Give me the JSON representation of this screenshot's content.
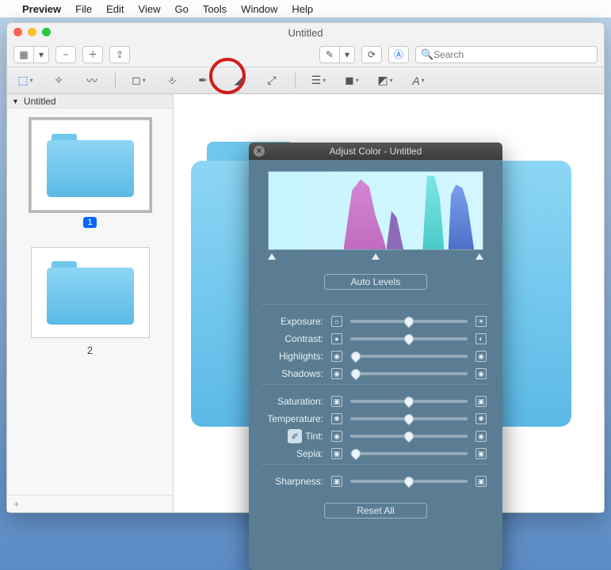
{
  "menubar": {
    "apple": "",
    "app": "Preview",
    "items": [
      "File",
      "Edit",
      "View",
      "Go",
      "Tools",
      "Window",
      "Help"
    ]
  },
  "window": {
    "title": "Untitled",
    "search_placeholder": "Search",
    "sidebar_title": "Untitled",
    "thumbs": [
      {
        "page": "1",
        "selected": true
      },
      {
        "page": "2",
        "selected": false
      }
    ],
    "add_icon": "+"
  },
  "panel": {
    "title": "Adjust Color - Untitled",
    "auto_levels": "Auto Levels",
    "reset": "Reset All",
    "groups": [
      {
        "name": "light",
        "rows": [
          {
            "key": "exposure",
            "label": "Exposure:",
            "pos": 50,
            "left_icon": "☼",
            "right_icon": "☀"
          },
          {
            "key": "contrast",
            "label": "Contrast:",
            "pos": 50,
            "left_icon": "●",
            "right_icon": "◐"
          },
          {
            "key": "highlights",
            "label": "Highlights:",
            "pos": 5,
            "left_icon": "◉",
            "right_icon": "◉"
          },
          {
            "key": "shadows",
            "label": "Shadows:",
            "pos": 5,
            "left_icon": "◉",
            "right_icon": "◉"
          }
        ]
      },
      {
        "name": "color",
        "rows": [
          {
            "key": "saturation",
            "label": "Saturation:",
            "pos": 50,
            "left_icon": "▣",
            "right_icon": "▣"
          },
          {
            "key": "temperature",
            "label": "Temperature:",
            "pos": 50,
            "left_icon": "✺",
            "right_icon": "✺"
          },
          {
            "key": "tint",
            "label": "Tint:",
            "pos": 50,
            "left_icon": "◉",
            "right_icon": "◉",
            "dropper": true
          },
          {
            "key": "sepia",
            "label": "Sepia:",
            "pos": 5,
            "left_icon": "▣",
            "right_icon": "▣"
          }
        ]
      },
      {
        "name": "sharp",
        "rows": [
          {
            "key": "sharpness",
            "label": "Sharpness:",
            "pos": 50,
            "left_icon": "▣",
            "right_icon": "▣"
          }
        ]
      }
    ]
  }
}
